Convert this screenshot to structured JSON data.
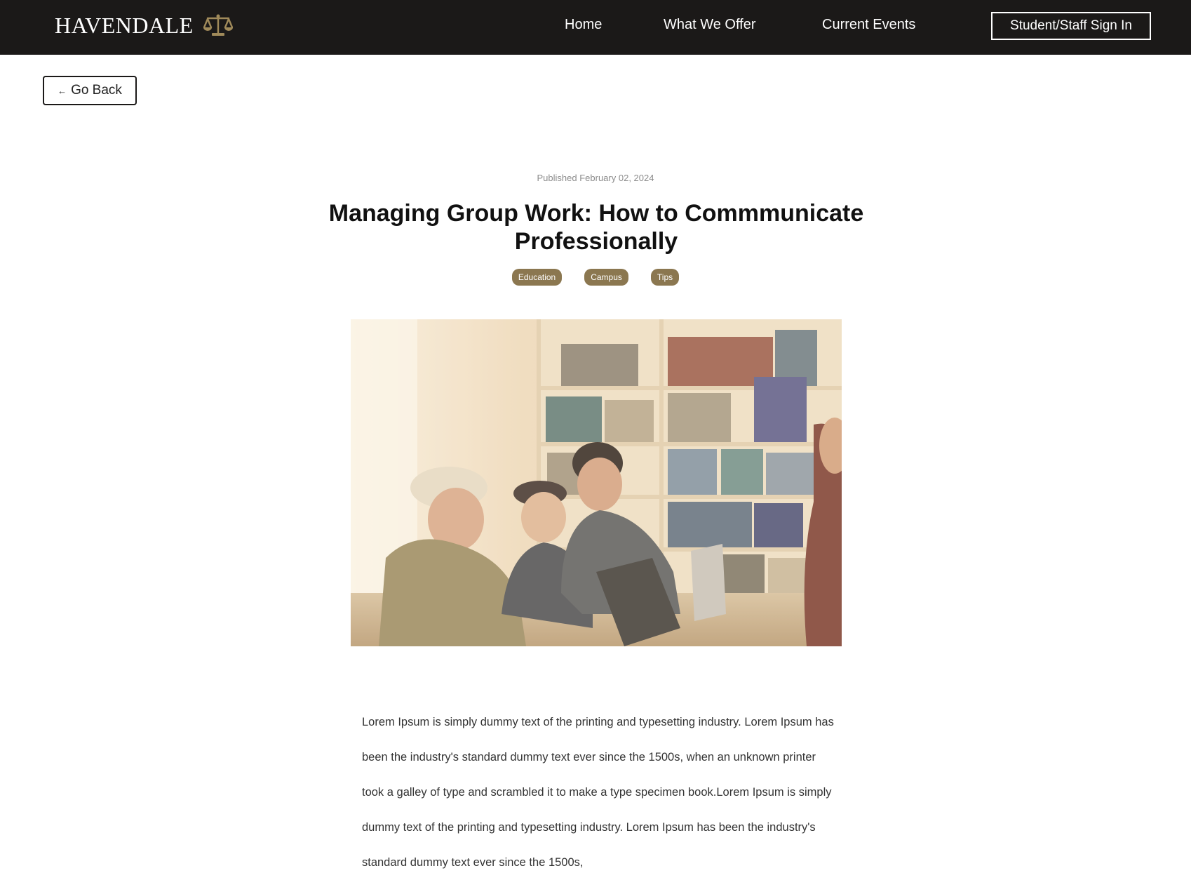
{
  "header": {
    "brand": "HAVENDALE",
    "brand_icon": "scales-icon",
    "nav": {
      "home": "Home",
      "offer": "What We Offer",
      "events": "Current Events"
    },
    "signin": "Student/Staff Sign In"
  },
  "back_button": {
    "arrow": "←",
    "label": "Go Back"
  },
  "article": {
    "published": "Published February 02, 2024",
    "title": "Managing Group Work: How to Commmunicate Professionally",
    "tags": [
      "Education",
      "Campus",
      "Tips"
    ],
    "body": "Lorem Ipsum is simply dummy text of the printing and typesetting industry. Lorem Ipsum has been the industry's standard dummy text ever since the 1500s, when an unknown printer took a galley of type and scrambled it to make a type specimen book.Lorem Ipsum is simply dummy text of the printing and typesetting industry. Lorem Ipsum has been the industry's standard dummy text ever since the 1500s,"
  },
  "colors": {
    "header_bg": "#1b1918",
    "accent_gold": "#8b7750",
    "text_dark": "#111111"
  }
}
